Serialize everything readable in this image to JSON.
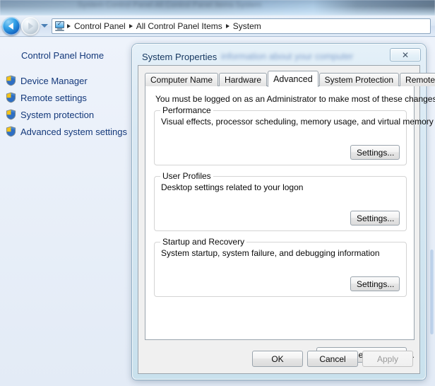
{
  "explorer": {
    "glass_blur_text": "System   Control Panel   All Control Panel Items   System",
    "nav": {
      "back_icon": "back-arrow-icon",
      "forward_icon": "forward-arrow-icon",
      "history_chevron_icon": "chevron-down-icon",
      "address_icon": "computer-icon"
    },
    "breadcrumbs": [
      {
        "label": "Control Panel"
      },
      {
        "label": "All Control Panel Items"
      },
      {
        "label": "System"
      }
    ]
  },
  "sidebar": {
    "home_label": "Control Panel Home",
    "items": [
      {
        "label": "Device Manager",
        "icon": "shield-icon"
      },
      {
        "label": "Remote settings",
        "icon": "shield-icon"
      },
      {
        "label": "System protection",
        "icon": "shield-icon"
      },
      {
        "label": "Advanced system settings",
        "icon": "shield-icon"
      }
    ]
  },
  "dialog": {
    "title": "System Properties",
    "title_background_ghost": "information about your computer",
    "close_label": "✕",
    "tabs": [
      {
        "label": "Computer Name",
        "active": false
      },
      {
        "label": "Hardware",
        "active": false
      },
      {
        "label": "Advanced",
        "active": true
      },
      {
        "label": "System Protection",
        "active": false
      },
      {
        "label": "Remote",
        "active": false
      }
    ],
    "admin_note": "You must be logged on as an Administrator to make most of these changes.",
    "groups": [
      {
        "legend": "Performance",
        "description": "Visual effects, processor scheduling, memory usage, and virtual memory",
        "button_label": "Settings..."
      },
      {
        "legend": "User Profiles",
        "description": "Desktop settings related to your logon",
        "button_label": "Settings..."
      },
      {
        "legend": "Startup and Recovery",
        "description": "System startup, system failure, and debugging information",
        "button_label": "Settings..."
      }
    ],
    "env_button_label": "Environment Variables...",
    "footer_buttons": [
      {
        "label": "OK",
        "disabled": false
      },
      {
        "label": "Cancel",
        "disabled": false
      },
      {
        "label": "Apply",
        "disabled": true
      }
    ]
  },
  "colors": {
    "accent_link": "#13387a",
    "desktop_background": "#e9eff8",
    "dialog_face": "#f0f0f0",
    "tab_active": "#ffffff",
    "shield_blue": "#2e6fc4",
    "shield_yellow": "#f2c21a"
  }
}
